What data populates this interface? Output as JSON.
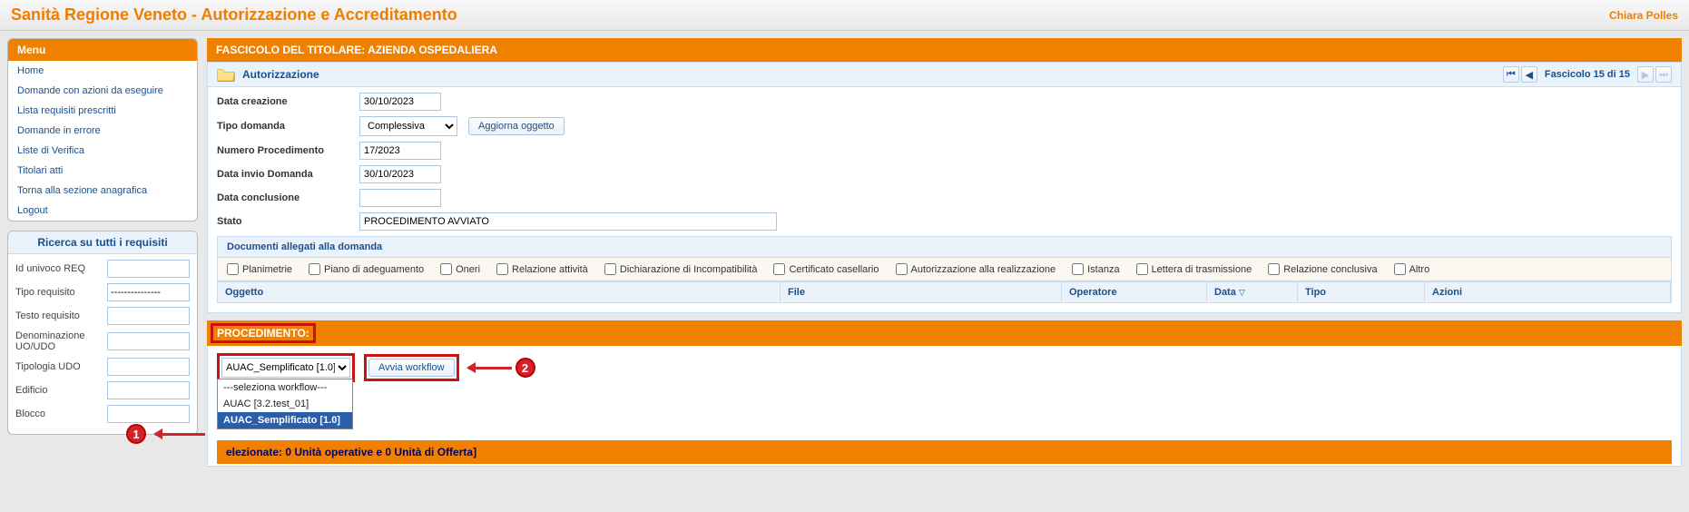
{
  "app_title": "Sanità Regione Veneto - Autorizzazione e Accreditamento",
  "user": "Chiara Polles",
  "sidebar": {
    "menu_title": "Menu",
    "items": [
      {
        "label": "Home"
      },
      {
        "label": "Domande con azioni da eseguire"
      },
      {
        "label": "Lista requisiti prescritti"
      },
      {
        "label": "Domande in errore"
      },
      {
        "label": "Liste di Verifica"
      },
      {
        "label": "Titolari atti"
      },
      {
        "label": "Torna alla sezione anagrafica"
      },
      {
        "label": "Logout"
      }
    ],
    "search_title": "Ricerca su tutti i requisiti",
    "fields": {
      "id_univoco": {
        "label": "Id univoco REQ",
        "value": ""
      },
      "tipo_requisito": {
        "label": "Tipo requisito",
        "value": "---------------"
      },
      "testo_requisito": {
        "label": "Testo requisito",
        "value": ""
      },
      "denominazione": {
        "label": "Denominazione UO/UDO",
        "value": ""
      },
      "tipologia_udo": {
        "label": "Tipologia UDO",
        "value": ""
      },
      "edificio": {
        "label": "Edificio",
        "value": ""
      },
      "blocco": {
        "label": "Blocco",
        "value": ""
      }
    }
  },
  "fascicolo": {
    "title_bar": "FASCICOLO DEL TITOLARE: AZIENDA OSPEDALIERA",
    "section": "Autorizzazione",
    "pager_text": "Fascicolo 15 di 15",
    "fields": {
      "data_creazione": {
        "label": "Data creazione",
        "value": "30/10/2023"
      },
      "tipo_domanda": {
        "label": "Tipo domanda",
        "value": "Complessiva"
      },
      "aggiorna_btn": "Aggiorna oggetto",
      "numero_proc": {
        "label": "Numero Procedimento",
        "value": "17/2023"
      },
      "data_invio": {
        "label": "Data invio Domanda",
        "value": "30/10/2023"
      },
      "data_conclusione": {
        "label": "Data conclusione",
        "value": ""
      },
      "stato": {
        "label": "Stato",
        "value": "PROCEDIMENTO AVVIATO"
      }
    }
  },
  "documenti": {
    "title": "Documenti allegati alla domanda",
    "filters": [
      "Planimetrie",
      "Piano di adeguamento",
      "Oneri",
      "Relazione attività",
      "Dichiarazione di Incompatibilità",
      "Certificato casellario",
      "Autorizzazione alla realizzazione",
      "Istanza",
      "Lettera di trasmissione",
      "Relazione conclusiva",
      "Altro"
    ],
    "columns": {
      "oggetto": "Oggetto",
      "file": "File",
      "operatore": "Operatore",
      "data": "Data",
      "tipo": "Tipo",
      "azioni": "Azioni"
    }
  },
  "procedimento": {
    "bar": "PROCEDIMENTO:",
    "selected": "AUAC_Semplificato [1.0]",
    "avvia_btn": "Avvia workflow",
    "options": [
      "---seleziona workflow---",
      "AUAC [3.2.test_01]",
      "AUAC_Semplificato [1.0]"
    ]
  },
  "footer": "elezionate: 0 Unità operative e 0 Unità di Offerta]",
  "annotations": {
    "one": "1",
    "two": "2"
  }
}
